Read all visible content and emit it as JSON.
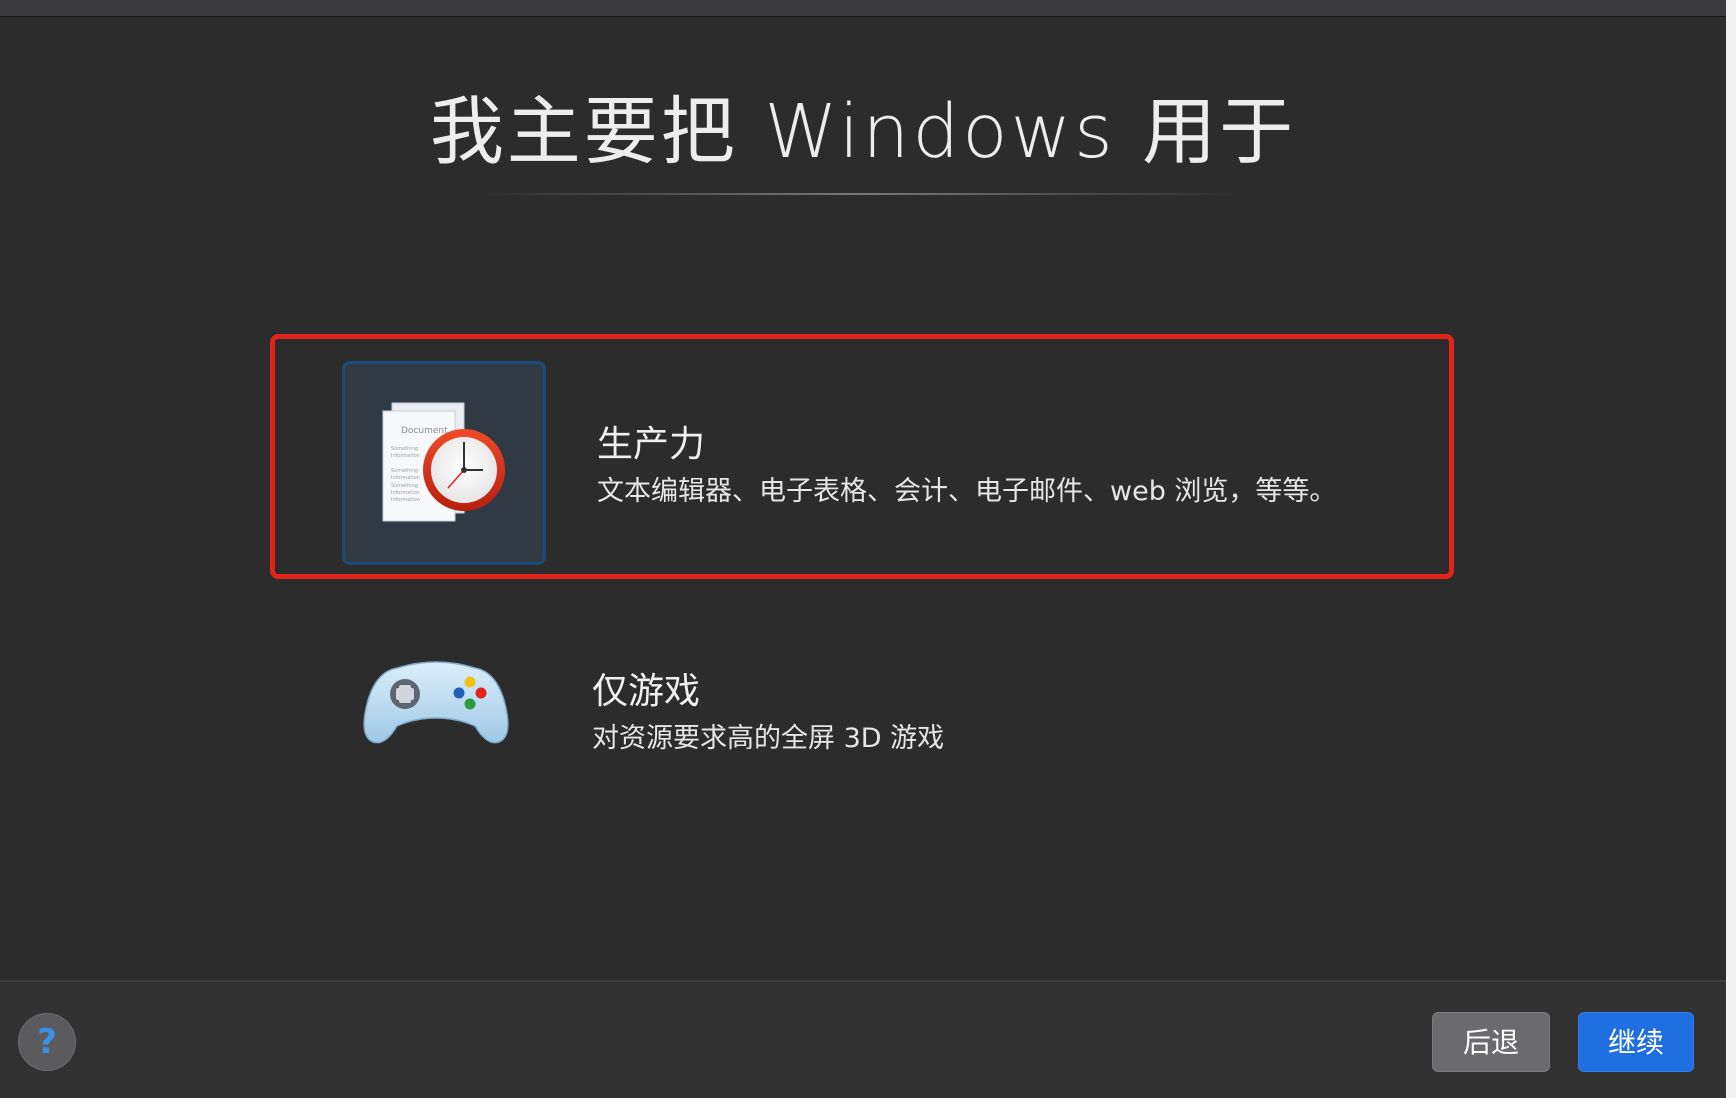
{
  "title": "我主要把 Windows 用于",
  "options": [
    {
      "id": "productivity",
      "title": "生产力",
      "description": "文本编辑器、电子表格、会计、电子邮件、web 浏览，等等。",
      "selected": true,
      "icon": "document-clock-icon",
      "icon_text": {
        "doc_heading": "Document",
        "doc_lines": [
          "Something",
          "Information",
          "Something",
          "Information",
          "Something",
          "Information",
          "Information"
        ]
      }
    },
    {
      "id": "games",
      "title": "仅游戏",
      "description": "对资源要求高的全屏 3D 游戏",
      "selected": false,
      "icon": "gamepad-icon"
    }
  ],
  "footer": {
    "help_label": "?",
    "back_label": "后退",
    "continue_label": "继续"
  },
  "colors": {
    "selection_border": "#e2231a",
    "accent": "#1f6fe0"
  }
}
